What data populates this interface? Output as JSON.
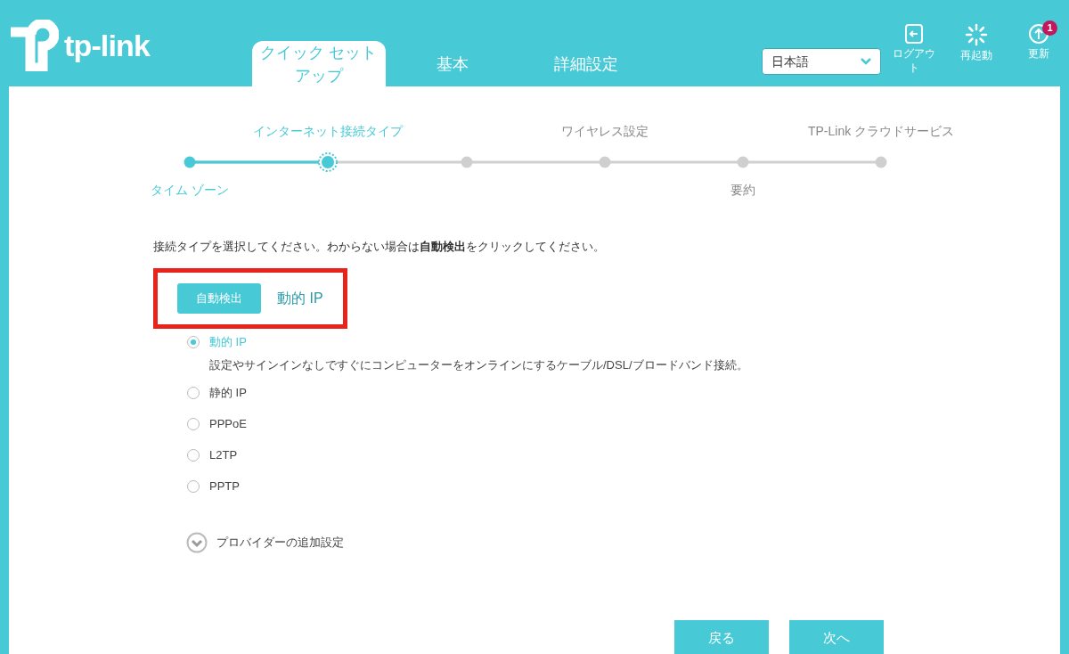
{
  "header": {
    "logo": "tp-link",
    "tabs": [
      {
        "label": "クイック セットアップ",
        "selected": true
      },
      {
        "label": "基本",
        "selected": false
      },
      {
        "label": "詳細設定",
        "selected": false
      }
    ],
    "language": {
      "value": "日本語"
    },
    "actions": [
      {
        "kind": "logout",
        "label": "ログアウト"
      },
      {
        "kind": "reboot",
        "label": "再起動"
      },
      {
        "kind": "update",
        "label": "更新",
        "badge": "1"
      }
    ]
  },
  "stepper": [
    {
      "label": "タイム ゾーン",
      "kind": "below",
      "completed": true,
      "selected": false
    },
    {
      "label": "インターネット接続タイプ",
      "kind": "above",
      "completed": false,
      "selected": true
    },
    {
      "kind": "unlabeled",
      "completed": false,
      "selected": false
    },
    {
      "label": "ワイヤレス設定",
      "kind": "above",
      "completed": false,
      "selected": false
    },
    {
      "label": "要約",
      "kind": "below",
      "completed": false,
      "selected": false
    },
    {
      "label": "TP-Link クラウドサービス",
      "kind": "above",
      "completed": false,
      "selected": false
    }
  ],
  "instruction": "接続タイプを選択してください。わからない場合は**自動検出**をクリックしてください。",
  "auto_detect": {
    "button": "自動検出",
    "result": "動的 IP"
  },
  "connection_types": [
    {
      "label": "動的 IP",
      "selected": true,
      "description": "設定やサインインなしですぐにコンピューターをオンラインにするケーブル/DSL/ブロードバンド接続。"
    },
    {
      "label": "静的 IP",
      "selected": false
    },
    {
      "label": "PPPoE",
      "selected": false
    },
    {
      "label": "L2TP",
      "selected": false
    },
    {
      "label": "PPTP",
      "selected": false
    }
  ],
  "advanced": {
    "label": "プロバイダーの追加設定",
    "expanded": false
  },
  "buttons": [
    "戻る",
    "次へ"
  ]
}
